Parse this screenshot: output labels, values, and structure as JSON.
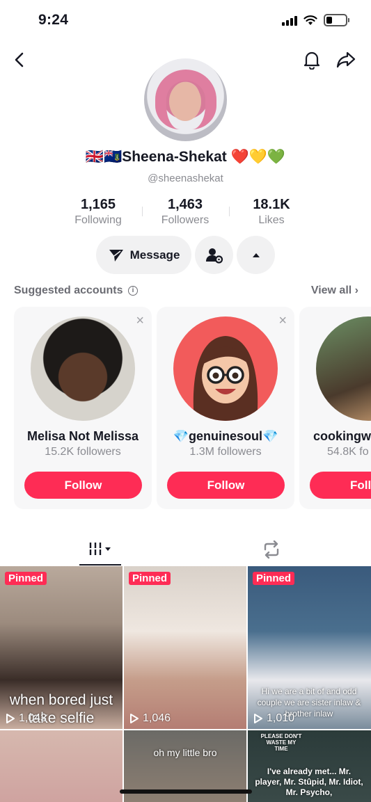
{
  "status_bar": {
    "time": "9:24",
    "battery_level": 0.3
  },
  "profile": {
    "name": "🇬🇧🇻🇬Sheena-Shekat ❤️💛💚",
    "handle": "@sheenashekat",
    "stats": [
      {
        "value": "1,165",
        "label": "Following"
      },
      {
        "value": "1,463",
        "label": "Followers"
      },
      {
        "value": "18.1K",
        "label": "Likes"
      }
    ],
    "message_label": "Message"
  },
  "suggested": {
    "title": "Suggested accounts",
    "view_all": "View all",
    "cards": [
      {
        "name": "Melisa Not Melissa",
        "followers": "15.2K followers",
        "follow_label": "Follow"
      },
      {
        "name": "💎genuinesoul💎",
        "followers": "1.3M followers",
        "follow_label": "Follow"
      },
      {
        "name": "cookingw",
        "followers": "54.8K fo",
        "follow_label": "Follo"
      }
    ]
  },
  "videos": [
    {
      "pinned": "Pinned",
      "views": "1,043",
      "caption": "when bored just take selfie"
    },
    {
      "pinned": "Pinned",
      "views": "1,046",
      "caption": ""
    },
    {
      "pinned": "Pinned",
      "views": "1,010",
      "caption": "Hi we are a bit of and odd couple we are sister inlaw & brother inlaw"
    },
    {
      "caption": ""
    },
    {
      "caption": "oh my little bro"
    },
    {
      "caption": "I've already met... Mr. player, Mr. Stûpid, Mr. Idiot, Mr. Psycho,",
      "stamp": "PLEASE DON'T WASTE MY TIME"
    }
  ],
  "colors": {
    "accent": "#fe2c55",
    "text": "#161823",
    "muted": "#8a8b91",
    "pill_bg": "#f1f1f2"
  }
}
